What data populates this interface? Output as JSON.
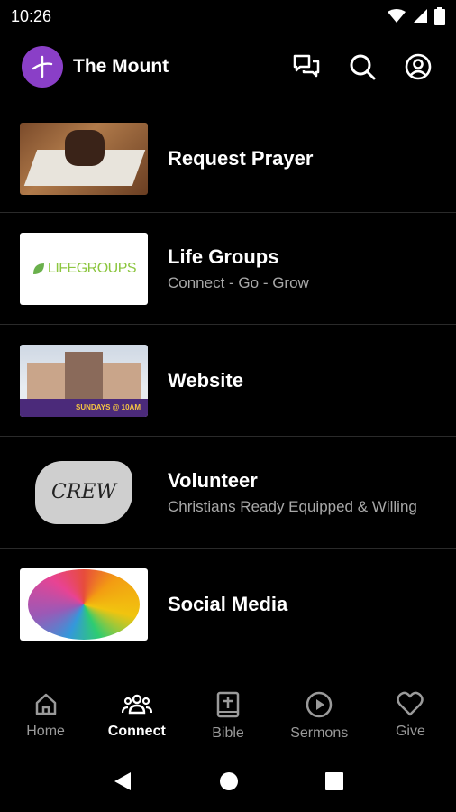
{
  "status_bar": {
    "time": "10:26"
  },
  "app_bar": {
    "title": "The Mount"
  },
  "list": [
    {
      "title": "Request Prayer",
      "subtitle": ""
    },
    {
      "title": "Life Groups",
      "subtitle": "Connect - Go - Grow",
      "thumb_text": "LIFEGROUPS"
    },
    {
      "title": "Website",
      "subtitle": "",
      "thumb_text": "SUNDAYS @ 10AM"
    },
    {
      "title": "Volunteer",
      "subtitle": "Christians Ready Equipped & Willing",
      "thumb_text": "CREW"
    },
    {
      "title": "Social Media",
      "subtitle": ""
    }
  ],
  "bottom_nav": [
    {
      "label": "Home",
      "icon": "home-icon",
      "active": false
    },
    {
      "label": "Connect",
      "icon": "people-icon",
      "active": true
    },
    {
      "label": "Bible",
      "icon": "bible-icon",
      "active": false
    },
    {
      "label": "Sermons",
      "icon": "play-circle-icon",
      "active": false
    },
    {
      "label": "Give",
      "icon": "heart-icon",
      "active": false
    }
  ],
  "colors": {
    "background": "#000000",
    "accent": "#8a3fc7",
    "muted_text": "#a8a8a8"
  }
}
